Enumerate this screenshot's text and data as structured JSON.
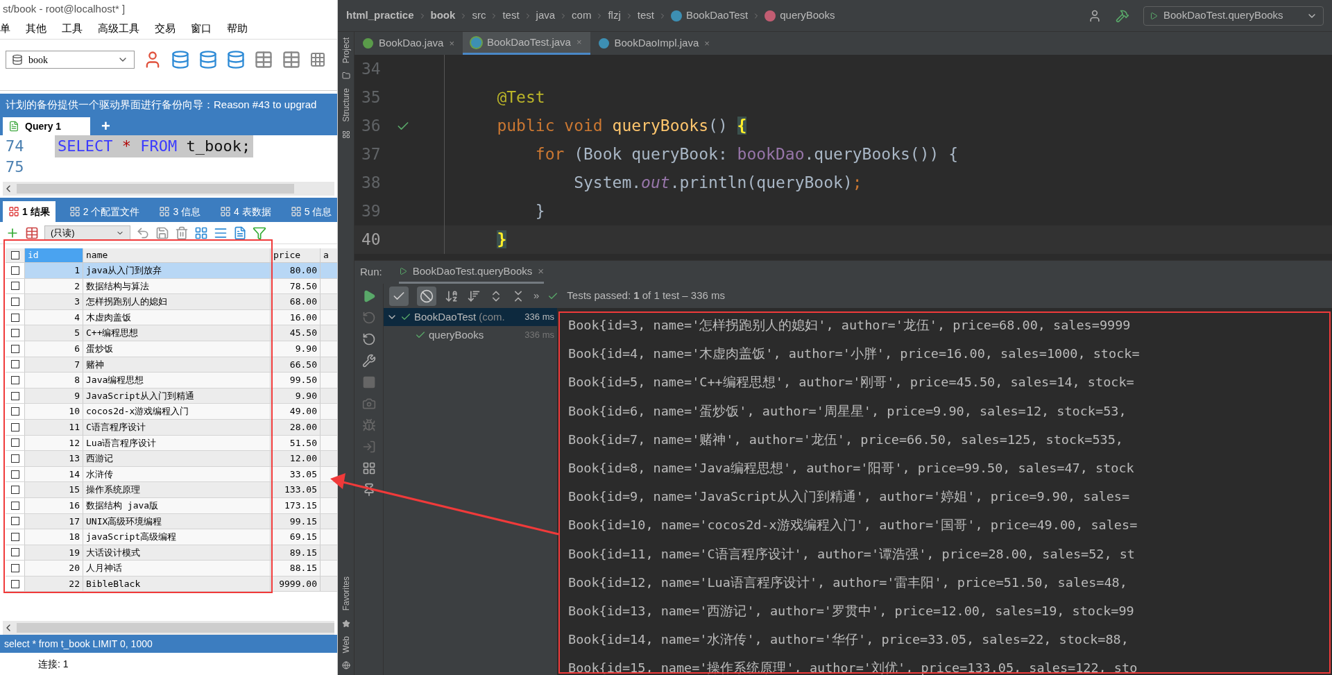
{
  "navicat": {
    "title": "st/book - root@localhost* ]",
    "menu": [
      "单",
      "其他",
      "工具",
      "高级工具",
      "交易",
      "窗口",
      "帮助"
    ],
    "database_select": {
      "value": "book"
    },
    "banner": "计划的备份提供一个驱动界面进行备份向导：Reason #43 to upgrad",
    "query_tabs": [
      {
        "label": "Query 1",
        "selected": true
      }
    ],
    "add_tab": "+",
    "sql_lines": [
      {
        "number": "74",
        "selected": true,
        "tokens": [
          {
            "kind": "keyword",
            "text": "SELECT"
          },
          {
            "kind": "operator",
            "text": "*"
          },
          {
            "kind": "keyword",
            "text": "FROM"
          },
          {
            "kind": "plain",
            "text": "t_book;"
          }
        ]
      },
      {
        "number": "75"
      }
    ],
    "result_tabs": [
      {
        "label": "1 结果",
        "selected": true
      },
      {
        "label": "2 个配置文件",
        "selected": false
      },
      {
        "label": "3 信息",
        "selected": false
      },
      {
        "label": "4 表数据",
        "selected": false
      },
      {
        "label": "5 信息",
        "selected": false
      }
    ],
    "readonly_select": "(只读)",
    "table": {
      "all_checked": false,
      "columns": [
        "id",
        "name",
        "price",
        "a"
      ],
      "rows": [
        {
          "id": "1",
          "name": "java从入门到放弃",
          "price": "80.00",
          "selected": true
        },
        {
          "id": "2",
          "name": "数据结构与算法",
          "price": "78.50",
          "selected": false
        },
        {
          "id": "3",
          "name": "怎样拐跑别人的媳妇",
          "price": "68.00",
          "selected": false
        },
        {
          "id": "4",
          "name": "木虚肉盖饭",
          "price": "16.00",
          "selected": false
        },
        {
          "id": "5",
          "name": "C++编程思想",
          "price": "45.50",
          "selected": false
        },
        {
          "id": "6",
          "name": "蛋炒饭",
          "price": "9.90",
          "selected": false
        },
        {
          "id": "7",
          "name": "赌神",
          "price": "66.50",
          "selected": false
        },
        {
          "id": "8",
          "name": "Java编程思想",
          "price": "99.50",
          "selected": false
        },
        {
          "id": "9",
          "name": "JavaScript从入门到精通",
          "price": "9.90",
          "selected": false
        },
        {
          "id": "10",
          "name": "cocos2d-x游戏编程入门",
          "price": "49.00",
          "selected": false
        },
        {
          "id": "11",
          "name": "C语言程序设计",
          "price": "28.00",
          "selected": false
        },
        {
          "id": "12",
          "name": "Lua语言程序设计",
          "price": "51.50",
          "selected": false
        },
        {
          "id": "13",
          "name": "西游记",
          "price": "12.00",
          "selected": false
        },
        {
          "id": "14",
          "name": "水浒传",
          "price": "33.05",
          "selected": false
        },
        {
          "id": "15",
          "name": "操作系统原理",
          "price": "133.05",
          "selected": false
        },
        {
          "id": "16",
          "name": "数据结构 java版",
          "price": "173.15",
          "selected": false
        },
        {
          "id": "17",
          "name": "UNIX高级环境编程",
          "price": "99.15",
          "selected": false
        },
        {
          "id": "18",
          "name": "javaScript高级编程",
          "price": "69.15",
          "selected": false
        },
        {
          "id": "19",
          "name": "大话设计模式",
          "price": "89.15",
          "selected": false
        },
        {
          "id": "20",
          "name": "人月神话",
          "price": "88.15",
          "selected": false
        },
        {
          "id": "22",
          "name": "BibleBlack",
          "price": "9999.00",
          "selected": false
        }
      ]
    },
    "status": "select * from t_book LIMIT 0, 1000",
    "connection": "连接: 1"
  },
  "ide": {
    "breadcrumbs": [
      {
        "label": "html_practice",
        "kind": "bold"
      },
      {
        "label": "book",
        "kind": "bold"
      },
      {
        "label": "src",
        "kind": "plain"
      },
      {
        "label": "test",
        "kind": "plain"
      },
      {
        "label": "java",
        "kind": "plain"
      },
      {
        "label": "com",
        "kind": "plain"
      },
      {
        "label": "flzj",
        "kind": "plain"
      },
      {
        "label": "test",
        "kind": "plain"
      },
      {
        "label": "BookDaoTest",
        "kind": "class"
      },
      {
        "label": "queryBooks",
        "kind": "method"
      }
    ],
    "run_config": "BookDaoTest.queryBooks",
    "editor_tabs": [
      {
        "label": "BookDao.java",
        "kind": "interface",
        "selected": false,
        "close": "×"
      },
      {
        "label": "BookDaoTest.java",
        "kind": "test",
        "selected": true,
        "close": "×"
      },
      {
        "label": "BookDaoImpl.java",
        "kind": "class",
        "selected": false,
        "close": "×"
      }
    ],
    "side_top": [
      "Project",
      "Structure"
    ],
    "side_bottom": [
      "Favorites",
      "Web"
    ],
    "code": [
      {
        "number": "34",
        "current": false
      },
      {
        "number": "35",
        "current": false,
        "tokens": [
          {
            "kind": "annotation",
            "text": "    @Test"
          }
        ]
      },
      {
        "number": "36",
        "current": false,
        "tokens": [
          {
            "kind": "keyword",
            "text": "    public void "
          },
          {
            "kind": "method",
            "text": "queryBooks"
          },
          {
            "kind": "plain",
            "text": "() "
          },
          {
            "kind": "brace",
            "text": "{"
          }
        ]
      },
      {
        "number": "37",
        "current": false,
        "tokens": [
          {
            "kind": "keyword",
            "text": "        for "
          },
          {
            "kind": "plain",
            "text": "(Book queryBook: "
          },
          {
            "kind": "field",
            "text": "bookDao"
          },
          {
            "kind": "plain",
            "text": ".queryBooks()) {"
          }
        ]
      },
      {
        "number": "38",
        "current": false,
        "tokens": [
          {
            "kind": "plain",
            "text": "            System."
          },
          {
            "kind": "static",
            "text": "out"
          },
          {
            "kind": "plain",
            "text": ".println(queryBook)"
          },
          {
            "kind": "punct",
            "text": ";"
          }
        ]
      },
      {
        "number": "39",
        "current": false,
        "tokens": [
          {
            "kind": "plain",
            "text": "        }"
          }
        ]
      },
      {
        "number": "40",
        "current": true,
        "tokens": [
          {
            "kind": "brace",
            "text": "    }"
          }
        ]
      }
    ],
    "run": {
      "label": "Run:",
      "tab": "BookDaoTest.queryBooks",
      "close": "×",
      "more": "»",
      "status": "Tests passed: **1** of 1 test – 336 ms",
      "tree": [
        {
          "label": "BookDaoTest",
          "detail": "(com.",
          "time": "336 ms",
          "selected": true,
          "expanded": true,
          "children": [
            {
              "label": "queryBooks",
              "time": "336 ms",
              "selected": false
            }
          ]
        }
      ],
      "console": [
        "Book{id=3, name='怎样拐跑别人的媳妇', author='龙伍', price=68.00, sales=9999",
        "Book{id=4, name='木虚肉盖饭', author='小胖', price=16.00, sales=1000, stock=",
        "Book{id=5, name='C++编程思想', author='刚哥', price=45.50, sales=14, stock=",
        "Book{id=6, name='蛋炒饭', author='周星星', price=9.90, sales=12, stock=53,",
        "Book{id=7, name='赌神', author='龙伍', price=66.50, sales=125, stock=535,",
        "Book{id=8, name='Java编程思想', author='阳哥', price=99.50, sales=47, stock",
        "Book{id=9, name='JavaScript从入门到精通', author='婷姐', price=9.90, sales=",
        "Book{id=10, name='cocos2d-x游戏编程入门', author='国哥', price=49.00, sales=",
        "Book{id=11, name='C语言程序设计', author='谭浩强', price=28.00, sales=52, st",
        "Book{id=12, name='Lua语言程序设计', author='雷丰阳', price=51.50, sales=48,",
        "Book{id=13, name='西游记', author='罗贯中', price=12.00, sales=19, stock=99",
        "Book{id=14, name='水浒传', author='华仔', price=33.05, sales=22, stock=88,",
        "Book{id=15, name='操作系统原理', author='刘优', price=133.05, sales=122, sto"
      ]
    }
  }
}
